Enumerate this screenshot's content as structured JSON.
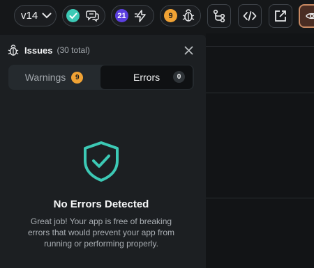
{
  "toolbar": {
    "version_label": "v14",
    "activity_count": "21",
    "issues_count": "9"
  },
  "issues_panel": {
    "title": "Issues",
    "total": "(30 total)",
    "tabs": [
      {
        "label": "Warnings",
        "count": "9"
      },
      {
        "label": "Errors",
        "count": "0"
      }
    ],
    "active_tab": "Errors",
    "empty_state": {
      "title": "No Errors Detected",
      "message": "Great job! Your app is free of breaking errors that would prevent your app from running or performing properly."
    }
  },
  "colors": {
    "success": "#3cc9b5",
    "activity": "#5b3fe0",
    "warning": "#f0a234",
    "accent_preview": "#c98a63"
  }
}
